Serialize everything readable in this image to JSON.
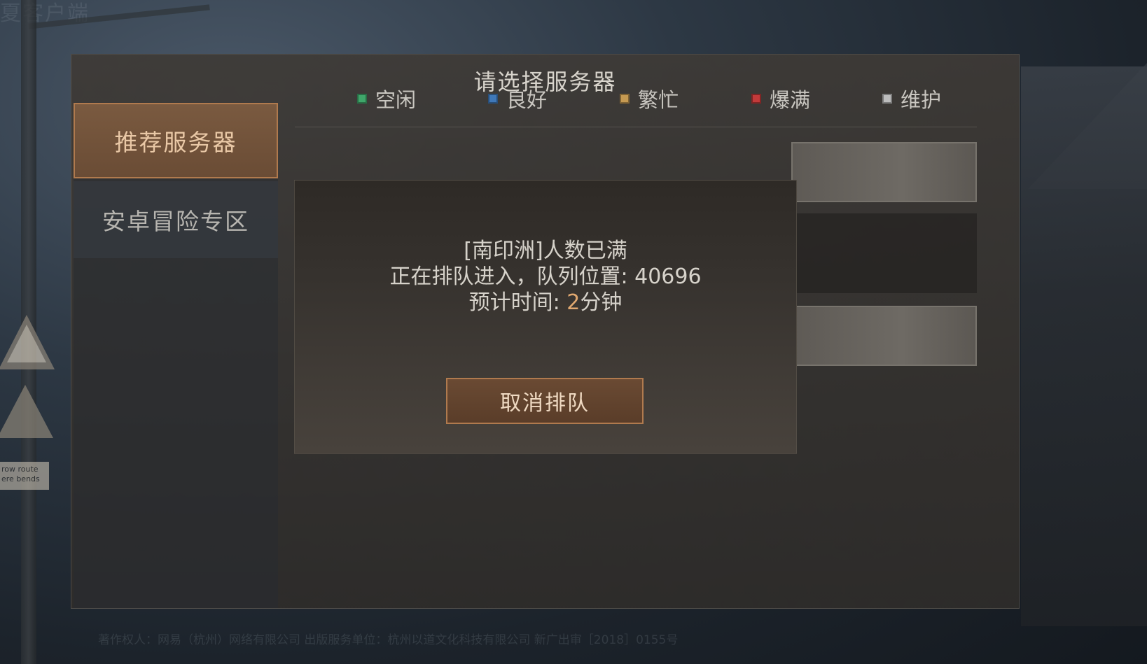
{
  "background": {
    "corner_text": "夏客户端",
    "sign_plate_text": "row route\nere bends",
    "footer_text": "著作权人：网易（杭州）网络有限公司    出版服务单位：杭州以道文化科技有限公司    新广出审［2018］0155号"
  },
  "panel": {
    "title": "请选择服务器"
  },
  "sidebar": {
    "tabs": [
      {
        "label": "推荐服务器",
        "active": true
      },
      {
        "label": "安卓冒险专区",
        "active": false
      }
    ]
  },
  "legend": {
    "items": [
      {
        "label": "空闲",
        "color": "#3fa66a"
      },
      {
        "label": "良好",
        "color": "#3f78b8"
      },
      {
        "label": "繁忙",
        "color": "#c69a52"
      },
      {
        "label": "爆满",
        "color": "#c23a3a"
      },
      {
        "label": "维护",
        "color": "#bdbdbd"
      }
    ]
  },
  "dialog": {
    "line1": "[南印洲]人数已满",
    "line2_prefix": "正在排队进入，队列位置: ",
    "queue_position": "40696",
    "line3_prefix": "预计时间: ",
    "eta_value": "2",
    "eta_unit": "分钟",
    "cancel_label": "取消排队"
  }
}
